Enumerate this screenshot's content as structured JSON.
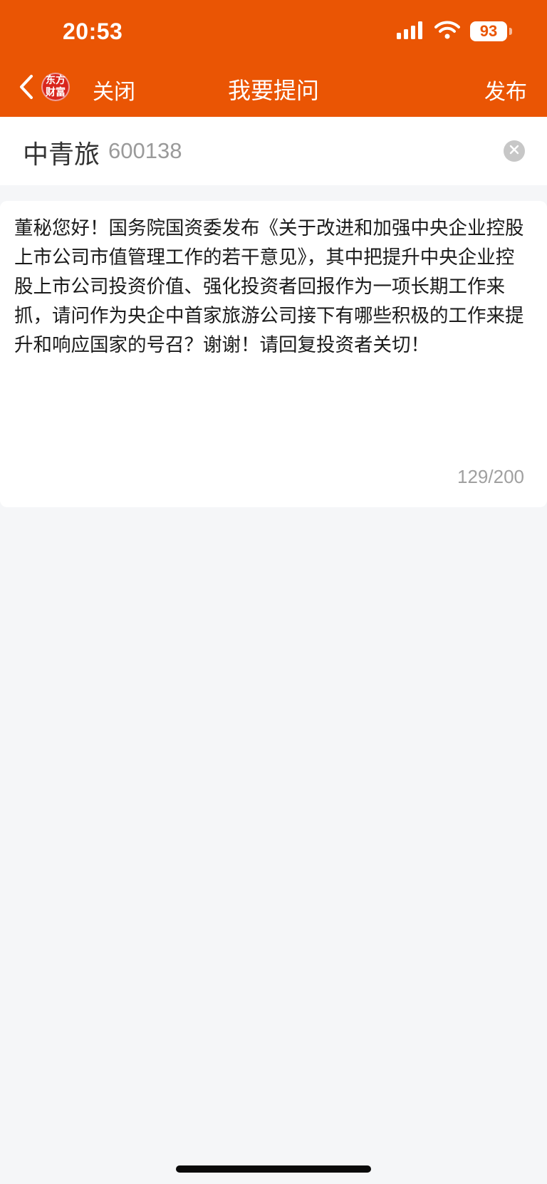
{
  "status_bar": {
    "time": "20:53",
    "battery": "93",
    "icons": [
      "signal-icon",
      "wifi-icon",
      "battery-icon"
    ]
  },
  "nav": {
    "logo_line1": "东方",
    "logo_line2": "财富",
    "close_label": "关闭",
    "title": "我要提问",
    "publish_label": "发布"
  },
  "stock": {
    "name": "中青旅",
    "code": "600138"
  },
  "question": {
    "text": "董秘您好！国务院国资委发布《关于改进和加强中央企业控股上市公司市值管理工作的若干意见》，其中把提升中央企业控股上市公司投资价值、强化投资者回报作为一项长期工作来抓，请问作为央企中首家旅游公司接下有哪些积极的工作来提升和响应国家的号召？谢谢！请回复投资者关切！",
    "char_count": "129/200"
  },
  "colors": {
    "brand": "#ea5504",
    "background": "#f5f6f8"
  }
}
